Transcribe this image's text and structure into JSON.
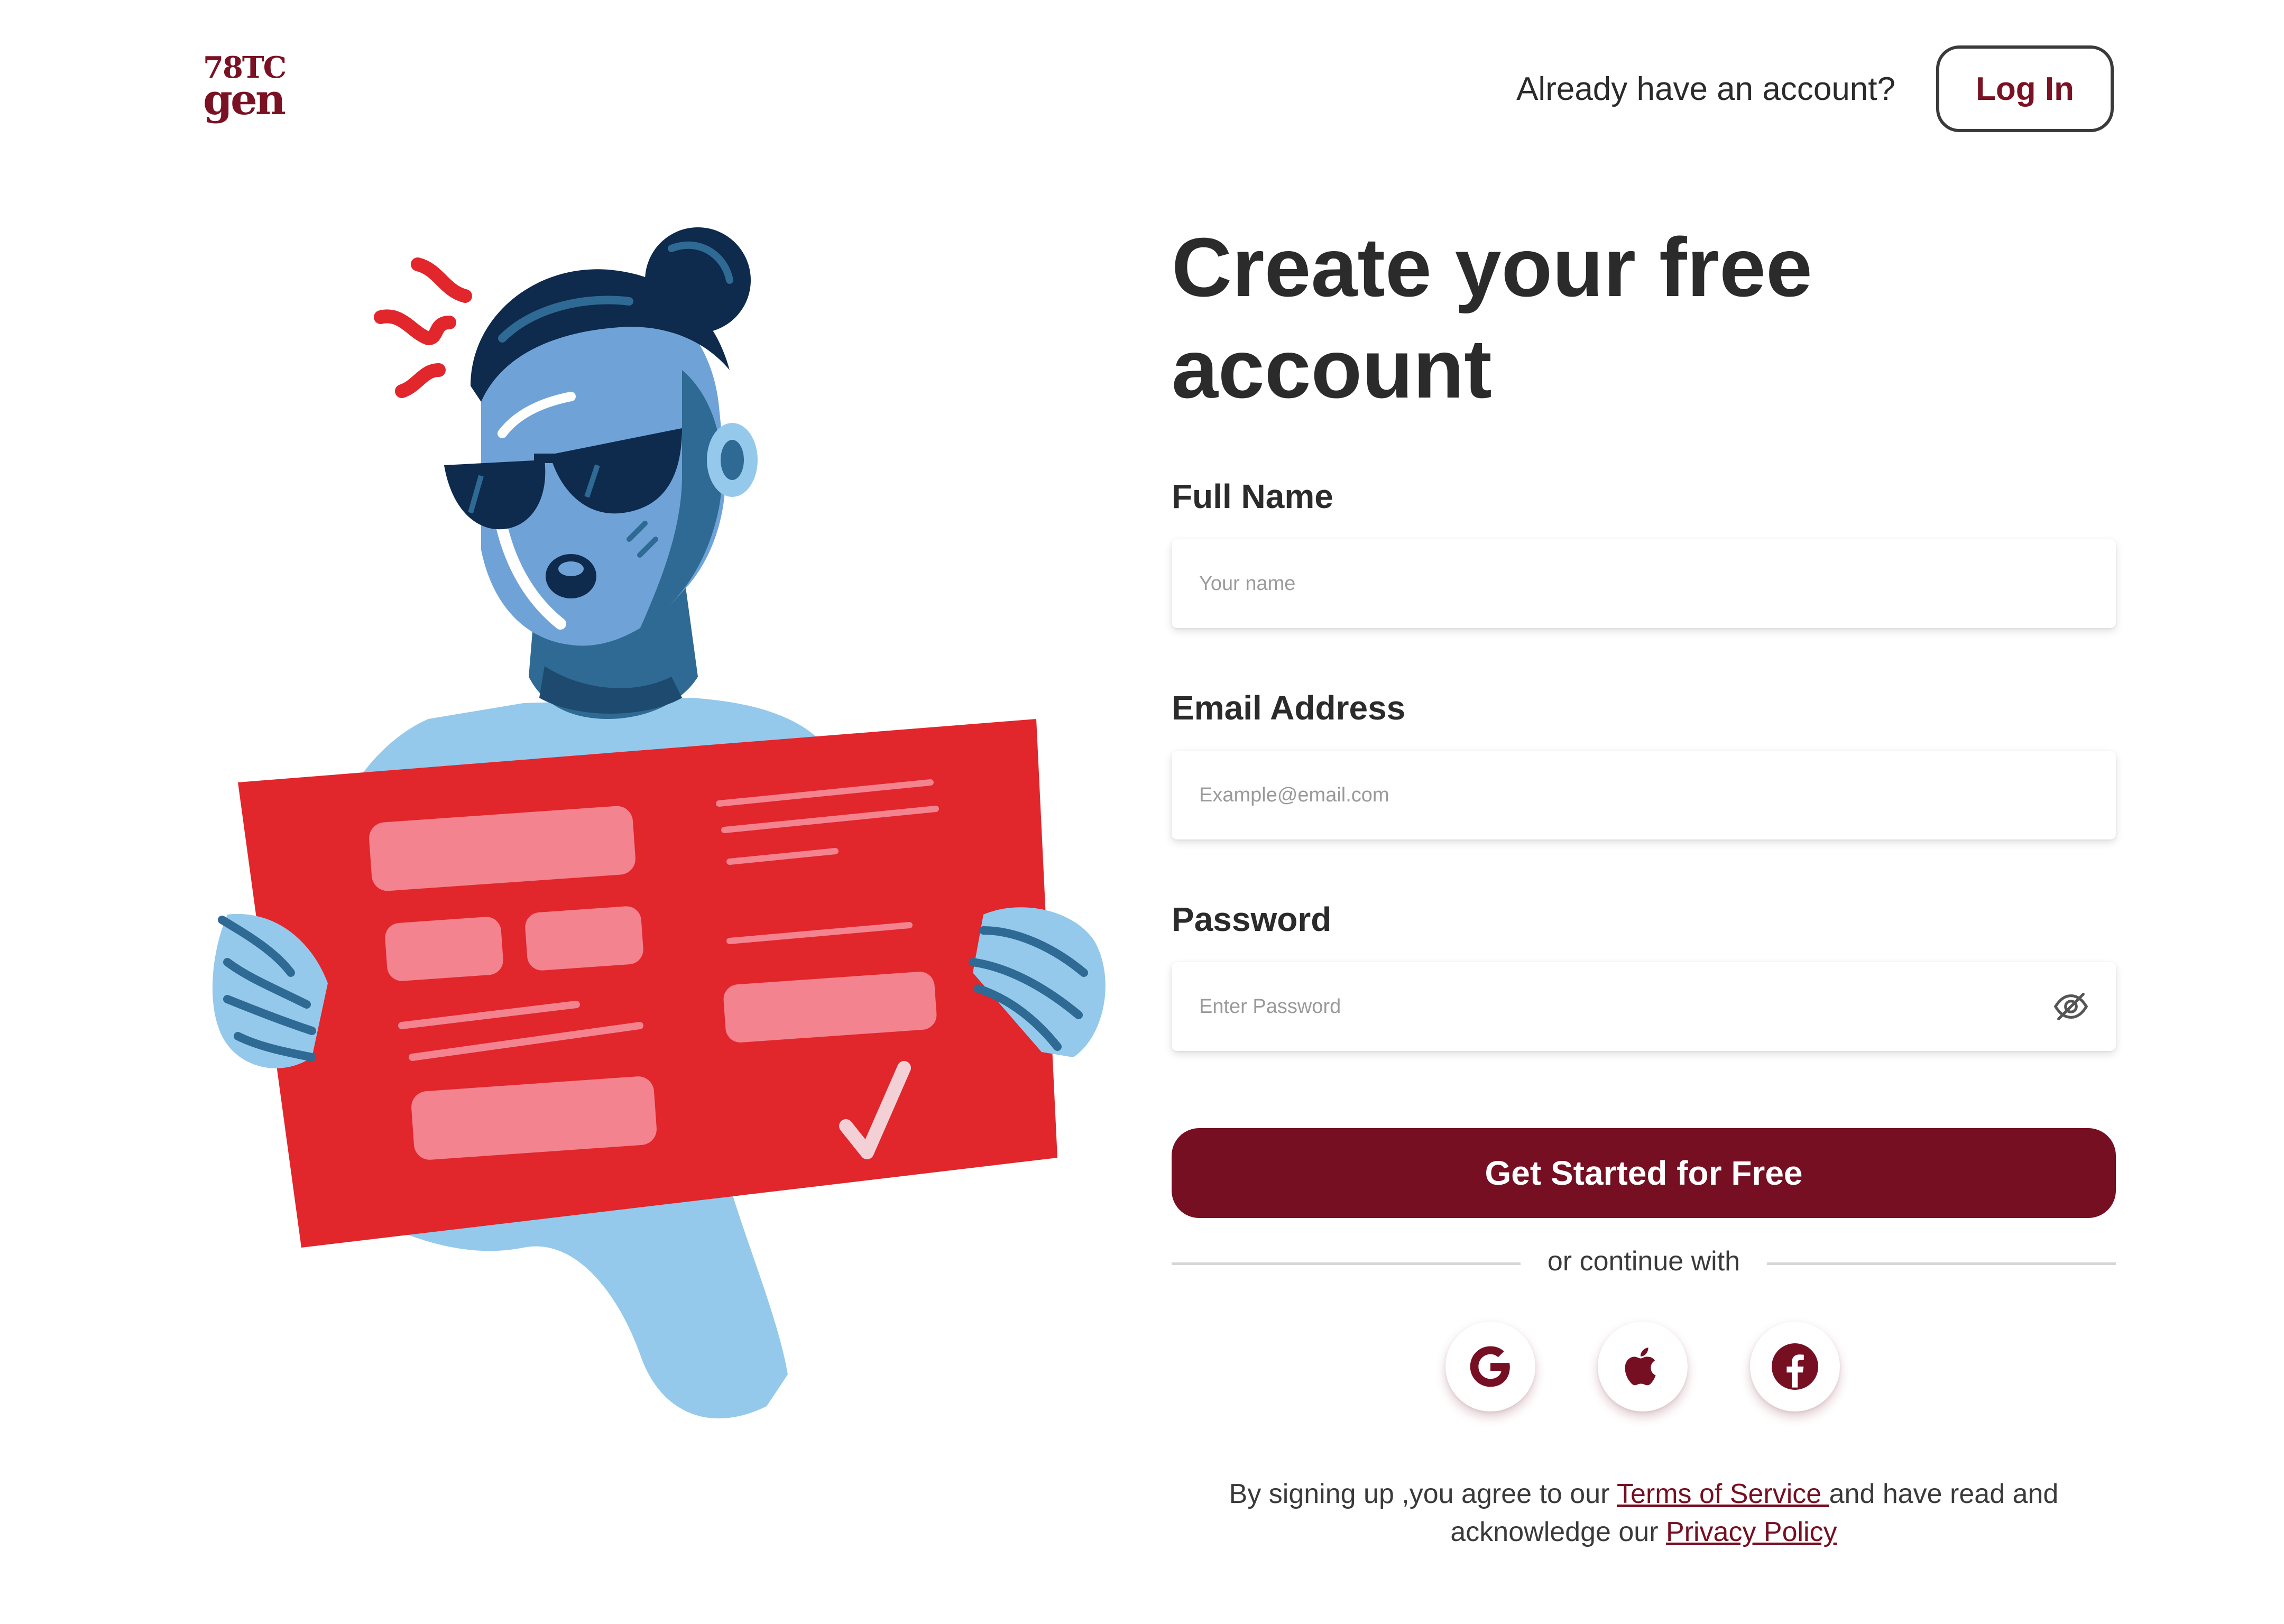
{
  "header": {
    "logo_line1": "78TC",
    "logo_line2": "gen",
    "already_text": "Already have an account?",
    "login_label": "Log In"
  },
  "form": {
    "title_line1": "Create your free",
    "title_line2": "account",
    "full_name_label": "Full Name",
    "full_name_placeholder": "Your name",
    "email_label": "Email Address",
    "email_placeholder": "Example@email.com",
    "password_label": "Password",
    "password_placeholder": "Enter Password",
    "password_toggle_icon": "eye-slash-icon",
    "submit_label": "Get Started for Free",
    "divider_text": "or continue with"
  },
  "social": [
    {
      "name": "google-icon"
    },
    {
      "name": "apple-icon"
    },
    {
      "name": "facebook-icon"
    }
  ],
  "legal": {
    "prefix": "By signing up ,you agree to our ",
    "terms_link": "Terms of Service ",
    "middle": "and have read and acknowledge our ",
    "privacy_link": "Privacy Policy"
  },
  "colors": {
    "brand": "#760f22",
    "illustration_red": "#e1262c",
    "illustration_pink": "#f3838f",
    "illustration_blue": "#94c9ec",
    "illustration_navy": "#0e2a4d"
  }
}
